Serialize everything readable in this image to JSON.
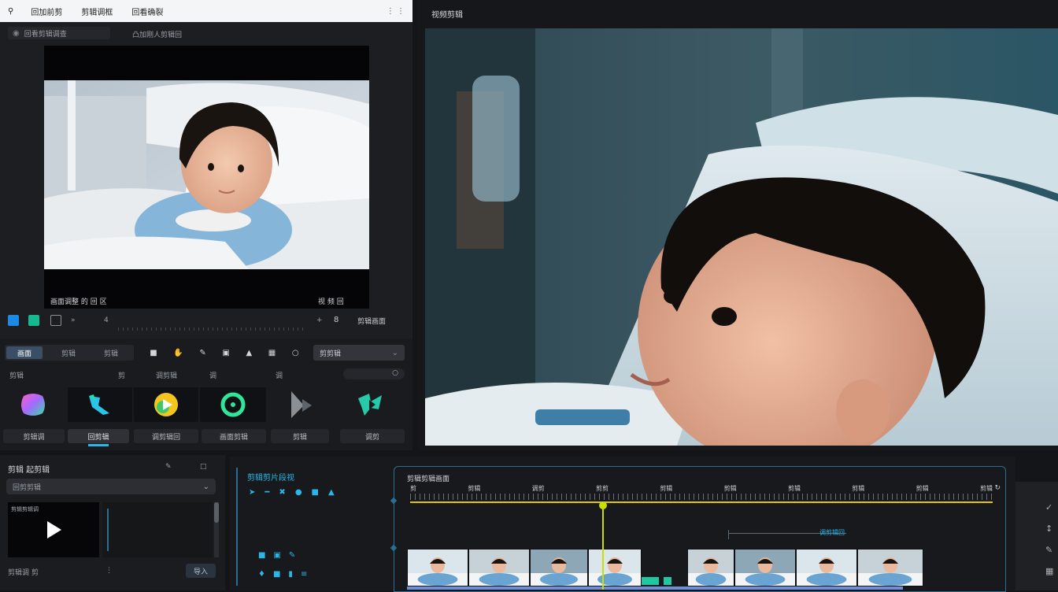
{
  "browser": {
    "search_icon": "search-icon",
    "tabs": [
      "回加前剪",
      "剪辑调框",
      "回看确裂"
    ],
    "menu_icon": "more-icon"
  },
  "preview_panel": {
    "title": "回看剪辑调查",
    "subtitle": "凸加刚人剪辑回",
    "caption_left": "画面调整 的 回 区",
    "caption_right": "视 频 回",
    "controls": {
      "speed": "»",
      "num": "4",
      "zoom": "+",
      "b_label": "8",
      "extra": "剪辑画面"
    }
  },
  "effects_panel": {
    "tabs": [
      "画面",
      "剪辑",
      "剪辑"
    ],
    "dropdown_label": "剪剪辑",
    "row_labels": [
      "剪辑",
      "剪",
      "调剪辑",
      "调",
      "调"
    ],
    "search_placeholder": "",
    "tiles": [
      "gradient-blob",
      "cyan-brush",
      "yellow-play",
      "green-ring",
      "grey-arrow",
      "cyan-shape"
    ],
    "tile_labels": [
      "剪辑调",
      "回剪辑",
      "调剪辑回",
      "画面剪辑",
      "剪辑",
      "调剪"
    ],
    "active_tile": 1
  },
  "large_preview": {
    "label": "视频剪辑"
  },
  "media_panel": {
    "title": "剪辑 起剪辑",
    "dropdown": "回剪剪辑",
    "thumb_label": "剪辑剪辑调",
    "footer_label": "剪辑调 剪",
    "import_button": "导入"
  },
  "timeline": {
    "left_header": "剪辑剪片段视",
    "ruler_title": "剪辑剪辑画面",
    "tick_labels": [
      "剪",
      "剪辑",
      "调剪",
      "剪剪",
      "剪辑",
      "剪辑",
      "剪辑",
      "剪辑",
      "剪辑",
      "剪辑"
    ],
    "marker_label": "调剪辑回",
    "playhead_time": 0.33,
    "clip_count": 8
  },
  "colors": {
    "accent": "#29b6e8",
    "playhead": "#c8e000",
    "yellow": "#e6c400"
  }
}
